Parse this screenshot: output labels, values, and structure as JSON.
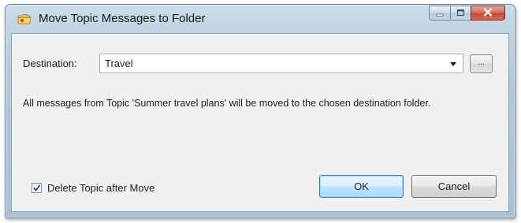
{
  "window": {
    "title": "Move Topic Messages to Folder",
    "caption_buttons": [
      "minimize-icon",
      "maximize-icon",
      "close-icon"
    ]
  },
  "destination": {
    "label": "Destination:",
    "value": "Travel",
    "browse_label": "..."
  },
  "message": "All messages from Topic 'Summer travel plans' will be moved to the chosen destination folder.",
  "delete_topic": {
    "label": "Delete Topic after Move",
    "checked": true
  },
  "buttons": {
    "ok": "OK",
    "cancel": "Cancel"
  },
  "colors": {
    "accent": "#3c7fb1",
    "close": "#c24a36",
    "frame": "#b3cadd"
  }
}
